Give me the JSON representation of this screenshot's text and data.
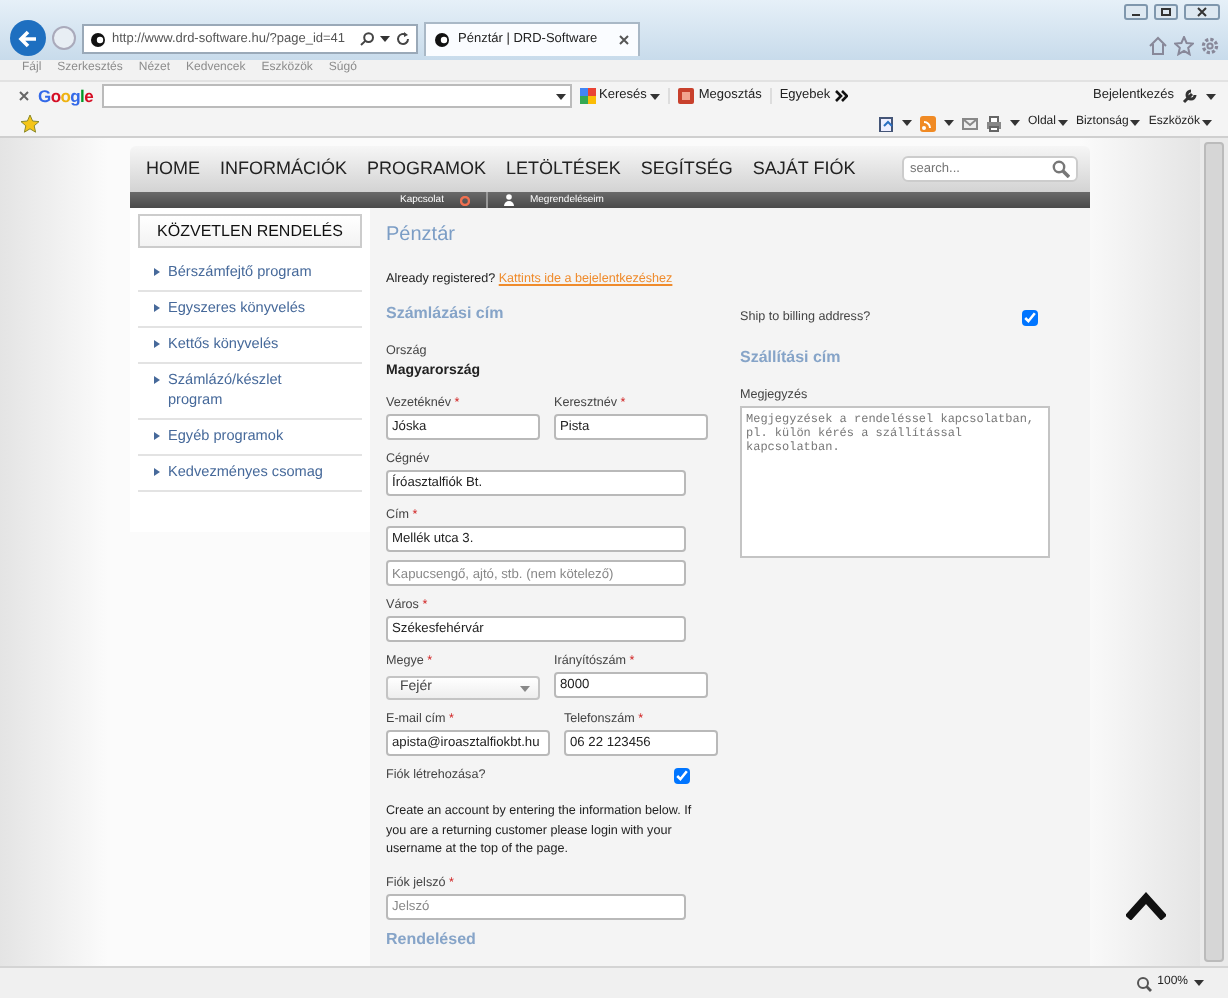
{
  "browser": {
    "url": "http://www.drd-software.hu/?page_id=41",
    "tab_title": "Pénztár | DRD-Software",
    "menu": [
      "Fájl",
      "Szerkesztés",
      "Nézet",
      "Kedvencek",
      "Eszközök",
      "Súgó"
    ],
    "google_toolbar": {
      "logo": "Google",
      "buttons": [
        "Keresés",
        "Megosztás",
        "Egyebek"
      ],
      "sign_in": "Bejelentkezés"
    },
    "command_bar": [
      "Oldal",
      "Biztonság",
      "Eszközök"
    ],
    "zoom": "100%"
  },
  "site": {
    "nav": [
      "HOME",
      "INFORMÁCIÓK",
      "PROGRAMOK",
      "LETÖLTÉSEK",
      "SEGÍTSÉG",
      "SAJÁT FIÓK"
    ],
    "search_placeholder": "search...",
    "subnav": [
      "Kapcsolat",
      "Megrendeléseim"
    ]
  },
  "sidebar": {
    "title": "KÖZVETLEN RENDELÉS",
    "items": [
      "Bérszámfejtő program",
      "Egyszeres könyvelés",
      "Kettős könyvelés",
      "Számlázó/készlet program",
      "Egyéb programok",
      "Kedvezményes csomag"
    ]
  },
  "checkout": {
    "title": "Pénztár",
    "login_prompt": "Already registered?",
    "login_link": "Kattints ide a bejelentkezéshez",
    "billing_heading": "Számlázási cím",
    "country_label": "Ország",
    "country": "Magyarország",
    "field_rows": [
      [
        {
          "label": "Vezetéknév",
          "mark": "*",
          "kind": "text",
          "value": "Jóska"
        },
        {
          "label": "Keresztnév",
          "mark": "*",
          "kind": "text",
          "value": "Pista"
        }
      ],
      [
        {
          "label": "Cégnév",
          "kind": "text",
          "value": "Íróasztalfiók Bt."
        }
      ],
      [
        {
          "label": "Cím",
          "mark": "*",
          "kind": "text",
          "value": "Mellék utca 3."
        }
      ],
      [
        {
          "kind": "text",
          "placeholder": "Kapucsengő, ajtó, stb. (nem kötelező)"
        }
      ],
      [
        {
          "label": "Város",
          "mark": "*",
          "kind": "text",
          "value": "Székesfehérvár"
        }
      ],
      [
        {
          "label": "Megye",
          "mark": "*",
          "kind": "select",
          "value": "Fejér"
        },
        {
          "label": "Irányítószám",
          "mark": "*",
          "kind": "text",
          "value": "8000"
        }
      ],
      [
        {
          "label": "E-mail cím",
          "mark": "*",
          "kind": "text",
          "value": "apista@iroasztalfiokbt.hu"
        },
        {
          "label": "Telefonszám",
          "mark": "*",
          "kind": "text",
          "value": "06 22 123456"
        }
      ]
    ],
    "create_account": {
      "label": "Fiók létrehozása?",
      "checked": true
    },
    "account_info": "Create an account by entering the information below. If you are a returning customer please login with your username at the top of the page.",
    "password": {
      "label": "Fiók jelszó",
      "mark": "*",
      "placeholder": "Jelszó"
    },
    "order_heading": "Rendelésed",
    "ship_to_billing": {
      "label": "Ship to billing address?",
      "checked": true
    },
    "shipping_heading": "Szállítási cím",
    "notes": {
      "label": "Megjegyzés",
      "placeholder": "Megjegyzések a rendeléssel kapcsolatban, pl. külön kérés a szállítással kapcsolatban."
    }
  }
}
